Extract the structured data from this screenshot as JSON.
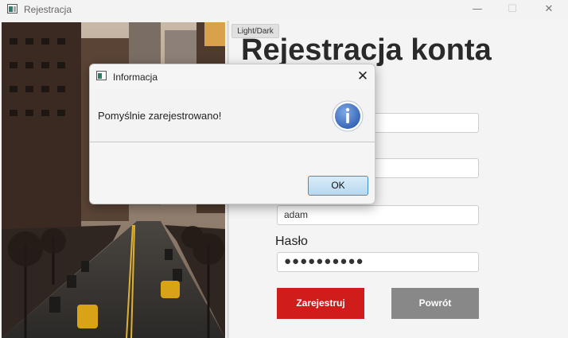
{
  "window": {
    "title": "Rejestracja",
    "minimize_glyph": "—",
    "maximize_glyph": "☐",
    "close_glyph": "✕"
  },
  "form": {
    "theme_button": "Light/Dark",
    "title": "Rejestracja konta",
    "field1_value": "",
    "field2_value": "",
    "username_value": "adam",
    "password_label": "Hasło",
    "password_value": "●●●●●●●●●●",
    "register_button": "Zarejestruj",
    "back_button": "Powrót"
  },
  "dialog": {
    "title": "Informacja",
    "close_glyph": "✕",
    "message": "Pomyślnie zarejestrowano!",
    "icon": "info-icon",
    "ok_button": "OK"
  },
  "colors": {
    "register": "#d11c1c",
    "back": "#888888",
    "info_icon": "#3f78c9"
  }
}
